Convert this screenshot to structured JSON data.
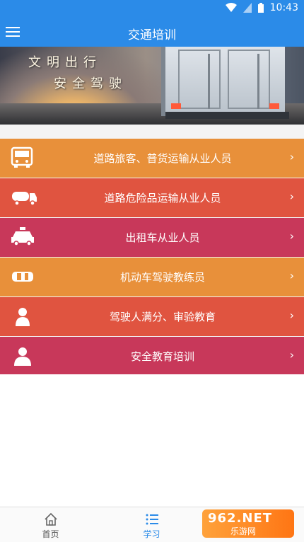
{
  "status_bar": {
    "time": "10:43"
  },
  "app_bar": {
    "title": "交通培训"
  },
  "banner": {
    "slogan_line1": "文明出行",
    "slogan_line2": "安全驾驶"
  },
  "menu": {
    "items": [
      {
        "label": "道路旅客、普货运输从业人员",
        "icon": "bus-icon",
        "color": "#e8903a"
      },
      {
        "label": "道路危险品运输从业人员",
        "icon": "tanker-truck-icon",
        "color": "#e05440"
      },
      {
        "label": "出租车从业人员",
        "icon": "taxi-icon",
        "color": "#c8385a"
      },
      {
        "label": "机动车驾驶教练员",
        "icon": "car-top-icon",
        "color": "#e8903a"
      },
      {
        "label": "驾驶人满分、审验教育",
        "icon": "person-icon",
        "color": "#e05440"
      },
      {
        "label": "安全教育培训",
        "icon": "person-icon",
        "color": "#c8385a"
      }
    ],
    "chevron": "›"
  },
  "tabs": [
    {
      "label": "首页",
      "icon": "home-icon",
      "active": false
    },
    {
      "label": "学习",
      "icon": "list-icon",
      "active": true
    }
  ],
  "watermark": {
    "main": "962.NET",
    "sub": "乐游网"
  },
  "colors": {
    "primary": "#2b8be8",
    "orange": "#e8903a",
    "red": "#e05440",
    "crimson": "#c8385a"
  }
}
